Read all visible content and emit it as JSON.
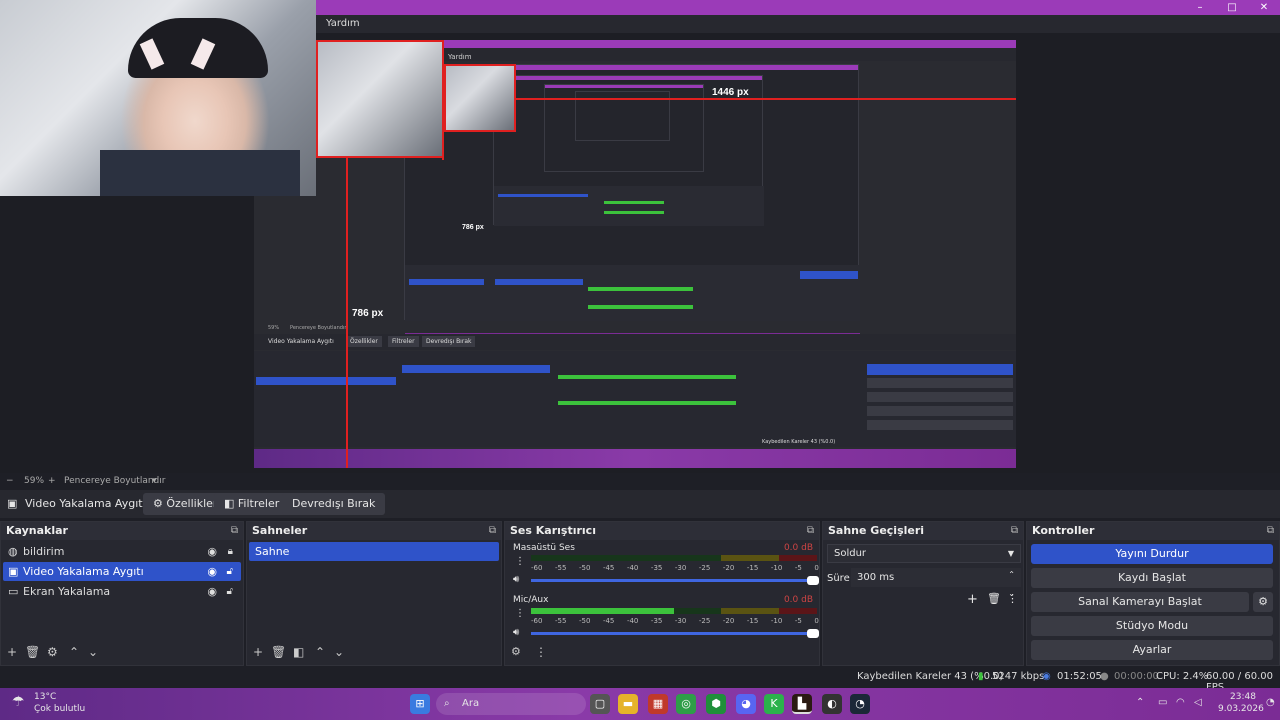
{
  "titlebar": {
    "minimize": "–",
    "maximize": "□",
    "close": "✕",
    "menu_help": "Yardım"
  },
  "canvas": {
    "inner_menu_help": "Yardım",
    "width_label": "1446 px",
    "height_label_1": "786 px",
    "height_label_2": "786 px",
    "inner_zoom": "59%",
    "inner_fit": "Pencereye Boyutlandır",
    "inner_source": "Video Yakalama Aygıtı",
    "inner_props": "Özellikler",
    "inner_filters": "Filtreler",
    "inner_disable": "Devredışı Bırak",
    "inner_status": "Kaybedilen Kareler 43 (%0.0)"
  },
  "zoom": {
    "minus": "−",
    "value": "59%",
    "plus": "+",
    "fit": "Pencereye Boyutlandır",
    "dropdown": "▾"
  },
  "source_toolbar": {
    "source_name": "Video Yakalama Aygıtı",
    "properties": "Özellikler",
    "filters": "Filtreler",
    "disable": "Devredışı Bırak"
  },
  "sources": {
    "title": "Kaynaklar",
    "items": [
      {
        "label": "bildirim",
        "icon": "globe-icon",
        "selected": false
      },
      {
        "label": "Video Yakalama Aygıtı",
        "icon": "camera-icon",
        "selected": true
      },
      {
        "label": "Ekran Yakalama",
        "icon": "monitor-icon",
        "selected": false
      }
    ]
  },
  "scenes": {
    "title": "Sahneler",
    "items": [
      {
        "label": "Sahne",
        "selected": true
      }
    ]
  },
  "mixer": {
    "title": "Ses Karıştırıcı",
    "tick_labels": [
      "-60",
      "-55",
      "-50",
      "-45",
      "-40",
      "-35",
      "-30",
      "-25",
      "-20",
      "-15",
      "-10",
      "-5",
      "0"
    ],
    "channels": [
      {
        "name": "Masaüstü Ses",
        "db": "0.0 dB",
        "level": 0.0,
        "volume": 1.0
      },
      {
        "name": "Mic/Aux",
        "db": "0.0 dB",
        "level": 0.5,
        "volume": 1.0
      }
    ]
  },
  "transitions": {
    "title": "Sahne Geçişleri",
    "type": "Soldur",
    "duration_label": "Süre",
    "duration": "300 ms"
  },
  "controls": {
    "title": "Kontroller",
    "stop_stream": "Yayını Durdur",
    "start_record": "Kaydı Başlat",
    "start_vcam": "Sanal Kamerayı Başlat",
    "studio_mode": "Stüdyo Modu",
    "settings": "Ayarlar"
  },
  "status": {
    "dropped": "Kaybedilen Kareler 43 (%0.0)",
    "bitrate": "5247 kbps",
    "stream_time": "01:52:05",
    "record_time": "00:00:00",
    "cpu": "CPU: 2.4%",
    "fps": "60.00 / 60.00 FPS"
  },
  "taskbar": {
    "weather_temp": "13°C",
    "weather_desc": "Çok bulutlu",
    "search": "Ara",
    "time": "23:48",
    "date": "9.03.2026",
    "brand_color": "#8a3aa8"
  }
}
